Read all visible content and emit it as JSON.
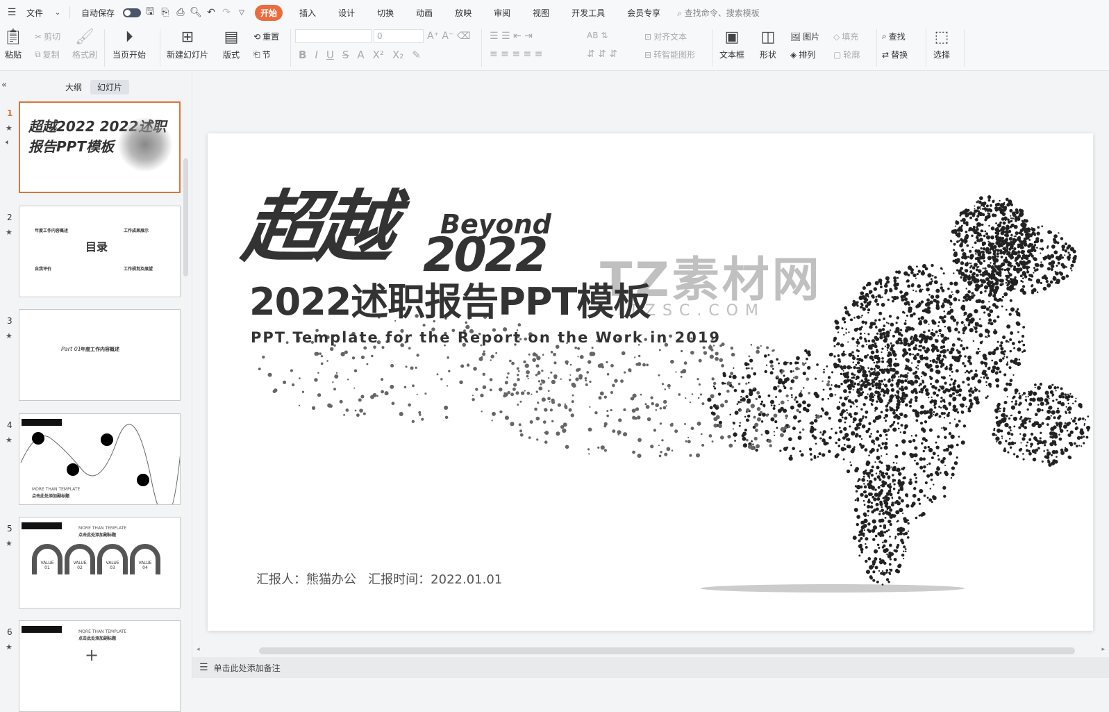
{
  "topbar": {
    "file": "文件",
    "autosave": "自动保存",
    "tabs": [
      "开始",
      "插入",
      "设计",
      "切换",
      "动画",
      "放映",
      "审阅",
      "视图",
      "开发工具",
      "会员专享"
    ],
    "active_tab": "开始",
    "search_placeholder": "查找命令、搜索模板",
    "accent": "#ec6b3d"
  },
  "ribbon": {
    "paste": "粘贴",
    "cut": "剪切",
    "copy": "复制",
    "format_painter": "格式刷",
    "play_from_current": "当页开始",
    "new_slide": "新建幻灯片",
    "layout": "版式",
    "reset": "重置",
    "section": "节",
    "font_size": "0",
    "align_text": "对齐文本",
    "smart_art": "转智能图形",
    "text_box": "文本框",
    "shape": "形状",
    "picture": "图片",
    "arrange": "排列",
    "fill": "填充",
    "outline": "轮廓",
    "find": "查找",
    "replace": "替换",
    "select": "选择"
  },
  "left_panel": {
    "tabs": [
      "大纲",
      "幻灯片"
    ],
    "active_tab": "幻灯片",
    "slides": [
      {
        "num": "1",
        "title": "超越2022 2022述职报告PPT模板"
      },
      {
        "num": "2",
        "title": "目录",
        "items": [
          "年度工作内容概述",
          "工作成果展示",
          "自我评价",
          "工作规划及展望"
        ]
      },
      {
        "num": "3",
        "title": "年度工作内容概述",
        "part": "Part 01"
      },
      {
        "num": "4",
        "caption": "MORE THAN TEMPLATE",
        "sub": "点击此处添加副标题"
      },
      {
        "num": "5",
        "caption": "MORE THAN TEMPLATE",
        "sub": "点击此处添加副标题",
        "values": [
          "VALUE 01",
          "VALUE 02",
          "VALUE 03",
          "VALUE 04"
        ]
      },
      {
        "num": "6",
        "caption": "MORE THAN TEMPLATE",
        "sub": "点击此处添加副标题"
      }
    ],
    "selected": "1"
  },
  "slide": {
    "big_title": "超越",
    "beyond": "Beyond",
    "year": "2022",
    "main_title": "2022述职报告PPT模板",
    "subtitle": "PPT Template for the Report on the Work in 2019",
    "reporter": "汇报人：熊猫办公",
    "report_time": "汇报时间：2022.01.01",
    "watermark": "TZ素材网",
    "watermark_url": "ITZSC.COM"
  },
  "notes": {
    "placeholder": "单击此处添加备注"
  }
}
